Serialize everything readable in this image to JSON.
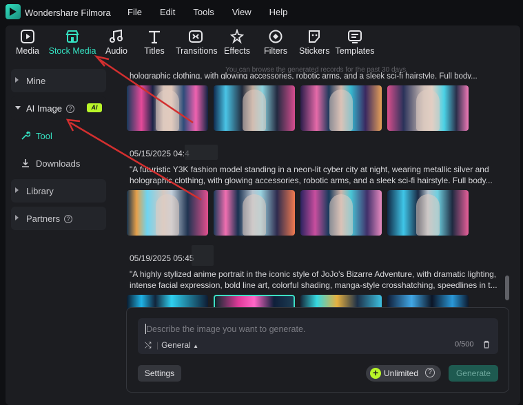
{
  "app": {
    "title": "Wondershare Filmora"
  },
  "menu": [
    "File",
    "Edit",
    "Tools",
    "View",
    "Help"
  ],
  "toolbar": {
    "items": [
      {
        "label": "Media",
        "icon": "media-icon",
        "active": false
      },
      {
        "label": "Stock Media",
        "icon": "stock-media-icon",
        "active": true
      },
      {
        "label": "Audio",
        "icon": "audio-icon",
        "active": false
      },
      {
        "label": "Titles",
        "icon": "titles-icon",
        "active": false
      },
      {
        "label": "Transitions",
        "icon": "transitions-icon",
        "active": false
      },
      {
        "label": "Effects",
        "icon": "effects-icon",
        "active": false
      },
      {
        "label": "Filters",
        "icon": "filters-icon",
        "active": false
      },
      {
        "label": "Stickers",
        "icon": "stickers-icon",
        "active": false
      },
      {
        "label": "Templates",
        "icon": "templates-icon",
        "active": false
      }
    ]
  },
  "sidebar": {
    "mine": "Mine",
    "ai_image": "AI Image",
    "ai_badge": "AI",
    "tool": "Tool",
    "downloads": "Downloads",
    "library": "Library",
    "partners": "Partners"
  },
  "content": {
    "note": "You can browse the generated records for the past 30 days.",
    "partial_prompt": "holographic clothing, with glowing accessories, robotic arms, and a sleek sci-fi hairstyle. Full body...",
    "records": [
      {
        "date": "05/15/2025 04:4",
        "prompt": "\"A futuristic Y3K fashion model standing in a neon-lit cyber city at night, wearing metallic silver and holographic clothing, with glowing accessories, robotic arms, and a sleek sci-fi hairstyle. Full body..."
      },
      {
        "date": "05/19/2025 05:45",
        "prompt": "\"A highly stylized anime portrait in the iconic style of JoJo's Bizarre Adventure, with dramatic lighting, intense facial expression, bold line art, colorful shading, manga-style crosshatching, speedlines in t..."
      }
    ]
  },
  "composer": {
    "placeholder": "Describe the image you want to generate.",
    "style": "General",
    "counter": "0/500",
    "settings": "Settings",
    "unlimited": "Unlimited",
    "generate": "Generate"
  },
  "colors": {
    "accent": "#35e2c2",
    "badge": "#b8f529",
    "arrow": "#d32f2f"
  }
}
